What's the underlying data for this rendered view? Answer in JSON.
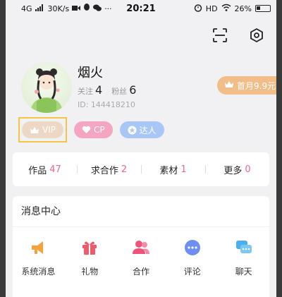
{
  "status_bar": {
    "network": "4G",
    "speed": "30K/s",
    "time": "20:21",
    "hd": "HD",
    "battery": "26%"
  },
  "top_actions": [
    {
      "icon": "scan-icon"
    },
    {
      "icon": "settings-icon"
    }
  ],
  "profile": {
    "nickname": "烟火",
    "following_label": "关注",
    "following_count": "4",
    "fans_label": "粉丝",
    "fans_count": "6",
    "user_id": "ID: 144418210"
  },
  "promo": {
    "label": "首月9.9元",
    "arrow": "›",
    "color": "#f1be8a"
  },
  "badges": {
    "vip": "VIP",
    "cp": "CP",
    "talent": "达人"
  },
  "works": [
    {
      "label": "作品",
      "count": "47"
    },
    {
      "label": "求合作",
      "count": "2"
    },
    {
      "label": "素材",
      "count": "1"
    },
    {
      "label": "更多",
      "count": "0"
    }
  ],
  "message_center": {
    "title": "消息中心",
    "items": [
      {
        "label": "系统消息",
        "icon": "megaphone-icon",
        "color": "#f5a13c"
      },
      {
        "label": "礼物",
        "icon": "gift-icon",
        "color": "#f05a6a"
      },
      {
        "label": "合作",
        "icon": "people-icon",
        "color": "#f0527a"
      },
      {
        "label": "评论",
        "icon": "comment-icon",
        "color": "#6e8ef0"
      },
      {
        "label": "聊天",
        "icon": "chat-icon",
        "color": "#4ab0f0"
      }
    ]
  },
  "colors": {
    "accent_pink": "#e86a88",
    "vip_highlight": "#f4c542"
  }
}
